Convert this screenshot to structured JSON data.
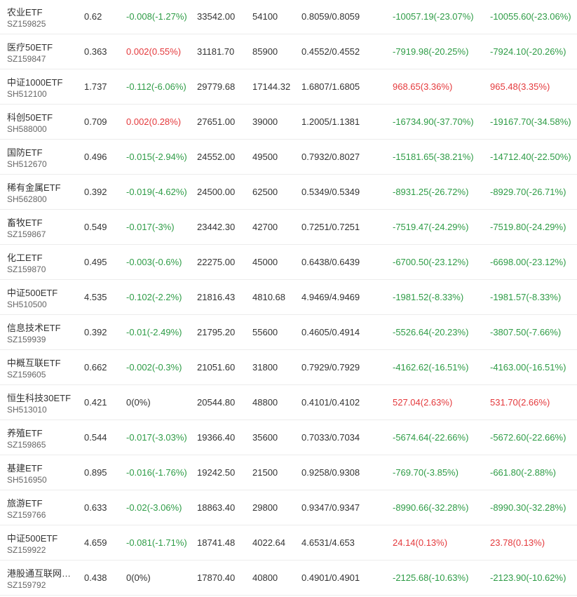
{
  "colors": {
    "up": "#e4393c",
    "down": "#2e9c46",
    "flat": "#333333"
  },
  "rows": [
    {
      "name": "农业ETF",
      "code": "SZ159825",
      "price": "0.62",
      "change": "-0.008(-1.27%)",
      "change_dir": "down",
      "amount": "33542.00",
      "volume": "54100",
      "nav": "0.8059/0.8059",
      "pnl1": "-10057.19(-23.07%)",
      "pnl1_dir": "down",
      "pnl2": "-10055.60(-23.06%)",
      "pnl2_dir": "down"
    },
    {
      "name": "医疗50ETF",
      "code": "SZ159847",
      "price": "0.363",
      "change": "0.002(0.55%)",
      "change_dir": "up",
      "amount": "31181.70",
      "volume": "85900",
      "nav": "0.4552/0.4552",
      "pnl1": "-7919.98(-20.25%)",
      "pnl1_dir": "down",
      "pnl2": "-7924.10(-20.26%)",
      "pnl2_dir": "down"
    },
    {
      "name": "中证1000ETF",
      "code": "SH512100",
      "price": "1.737",
      "change": "-0.112(-6.06%)",
      "change_dir": "down",
      "amount": "29779.68",
      "volume": "17144.32",
      "nav": "1.6807/1.6805",
      "pnl1": "968.65(3.36%)",
      "pnl1_dir": "up",
      "pnl2": "965.48(3.35%)",
      "pnl2_dir": "up"
    },
    {
      "name": "科创50ETF",
      "code": "SH588000",
      "price": "0.709",
      "change": "0.002(0.28%)",
      "change_dir": "up",
      "amount": "27651.00",
      "volume": "39000",
      "nav": "1.2005/1.1381",
      "pnl1": "-16734.90(-37.70%)",
      "pnl1_dir": "down",
      "pnl2": "-19167.70(-34.58%)",
      "pnl2_dir": "down"
    },
    {
      "name": "国防ETF",
      "code": "SH512670",
      "price": "0.496",
      "change": "-0.015(-2.94%)",
      "change_dir": "down",
      "amount": "24552.00",
      "volume": "49500",
      "nav": "0.7932/0.8027",
      "pnl1": "-15181.65(-38.21%)",
      "pnl1_dir": "down",
      "pnl2": "-14712.40(-22.50%)",
      "pnl2_dir": "down"
    },
    {
      "name": "稀有金属ETF",
      "code": "SH562800",
      "price": "0.392",
      "change": "-0.019(-4.62%)",
      "change_dir": "down",
      "amount": "24500.00",
      "volume": "62500",
      "nav": "0.5349/0.5349",
      "pnl1": "-8931.25(-26.72%)",
      "pnl1_dir": "down",
      "pnl2": "-8929.70(-26.71%)",
      "pnl2_dir": "down"
    },
    {
      "name": "畜牧ETF",
      "code": "SZ159867",
      "price": "0.549",
      "change": "-0.017(-3%)",
      "change_dir": "down",
      "amount": "23442.30",
      "volume": "42700",
      "nav": "0.7251/0.7251",
      "pnl1": "-7519.47(-24.29%)",
      "pnl1_dir": "down",
      "pnl2": "-7519.80(-24.29%)",
      "pnl2_dir": "down"
    },
    {
      "name": "化工ETF",
      "code": "SZ159870",
      "price": "0.495",
      "change": "-0.003(-0.6%)",
      "change_dir": "down",
      "amount": "22275.00",
      "volume": "45000",
      "nav": "0.6438/0.6439",
      "pnl1": "-6700.50(-23.12%)",
      "pnl1_dir": "down",
      "pnl2": "-6698.00(-23.12%)",
      "pnl2_dir": "down"
    },
    {
      "name": "中证500ETF",
      "code": "SH510500",
      "price": "4.535",
      "change": "-0.102(-2.2%)",
      "change_dir": "down",
      "amount": "21816.43",
      "volume": "4810.68",
      "nav": "4.9469/4.9469",
      "pnl1": "-1981.52(-8.33%)",
      "pnl1_dir": "down",
      "pnl2": "-1981.57(-8.33%)",
      "pnl2_dir": "down"
    },
    {
      "name": "信息技术ETF",
      "code": "SZ159939",
      "price": "0.392",
      "change": "-0.01(-2.49%)",
      "change_dir": "down",
      "amount": "21795.20",
      "volume": "55600",
      "nav": "0.4605/0.4914",
      "pnl1": "-5526.64(-20.23%)",
      "pnl1_dir": "down",
      "pnl2": "-3807.50(-7.66%)",
      "pnl2_dir": "down"
    },
    {
      "name": "中概互联ETF",
      "code": "SZ159605",
      "price": "0.662",
      "change": "-0.002(-0.3%)",
      "change_dir": "down",
      "amount": "21051.60",
      "volume": "31800",
      "nav": "0.7929/0.7929",
      "pnl1": "-4162.62(-16.51%)",
      "pnl1_dir": "down",
      "pnl2": "-4163.00(-16.51%)",
      "pnl2_dir": "down"
    },
    {
      "name": "恒生科技30ETF",
      "code": "SH513010",
      "price": "0.421",
      "change": "0(0%)",
      "change_dir": "flat",
      "amount": "20544.80",
      "volume": "48800",
      "nav": "0.4101/0.4102",
      "pnl1": "527.04(2.63%)",
      "pnl1_dir": "up",
      "pnl2": "531.70(2.66%)",
      "pnl2_dir": "up"
    },
    {
      "name": "养殖ETF",
      "code": "SZ159865",
      "price": "0.544",
      "change": "-0.017(-3.03%)",
      "change_dir": "down",
      "amount": "19366.40",
      "volume": "35600",
      "nav": "0.7033/0.7034",
      "pnl1": "-5674.64(-22.66%)",
      "pnl1_dir": "down",
      "pnl2": "-5672.60(-22.66%)",
      "pnl2_dir": "down"
    },
    {
      "name": "基建ETF",
      "code": "SH516950",
      "price": "0.895",
      "change": "-0.016(-1.76%)",
      "change_dir": "down",
      "amount": "19242.50",
      "volume": "21500",
      "nav": "0.9258/0.9308",
      "pnl1": "-769.70(-3.85%)",
      "pnl1_dir": "down",
      "pnl2": "-661.80(-2.88%)",
      "pnl2_dir": "down"
    },
    {
      "name": "旅游ETF",
      "code": "SZ159766",
      "price": "0.633",
      "change": "-0.02(-3.06%)",
      "change_dir": "down",
      "amount": "18863.40",
      "volume": "29800",
      "nav": "0.9347/0.9347",
      "pnl1": "-8990.66(-32.28%)",
      "pnl1_dir": "down",
      "pnl2": "-8990.30(-32.28%)",
      "pnl2_dir": "down"
    },
    {
      "name": "中证500ETF",
      "code": "SZ159922",
      "price": "4.659",
      "change": "-0.081(-1.71%)",
      "change_dir": "down",
      "amount": "18741.48",
      "volume": "4022.64",
      "nav": "4.6531/4.653",
      "pnl1": "24.14(0.13%)",
      "pnl1_dir": "up",
      "pnl2": "23.78(0.13%)",
      "pnl2_dir": "up"
    },
    {
      "name": "港股通互联网…",
      "code": "SZ159792",
      "price": "0.438",
      "change": "0(0%)",
      "change_dir": "flat",
      "amount": "17870.40",
      "volume": "40800",
      "nav": "0.4901/0.4901",
      "pnl1": "-2125.68(-10.63%)",
      "pnl1_dir": "down",
      "pnl2": "-2123.90(-10.62%)",
      "pnl2_dir": "down"
    }
  ]
}
